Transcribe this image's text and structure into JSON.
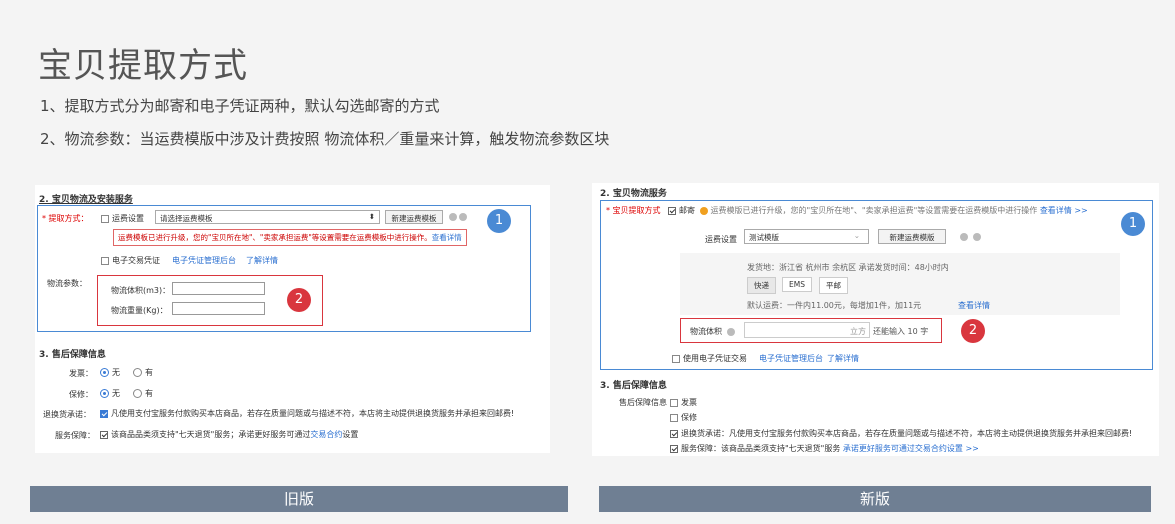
{
  "slide": {
    "title": "宝贝提取方式",
    "point1": "1、提取方式分为邮寄和电子凭证两种，默认勾选邮寄的方式",
    "point2": "2、物流参数：当运费模版中涉及计费按照 物流体积／重量来计算，触发物流参数区块"
  },
  "old": {
    "section2": "2. 宝贝物流及安装服务",
    "method_label": "* 提取方式：",
    "freight_option": "运费设置",
    "freight_select": "请选择运费模板",
    "new_template_btn": "新建运费模板",
    "notice": "运费模板已进行升级，您的\"宝贝所在地\"、\"卖家承担运费\"等设置需要在运费模板中进行操作。",
    "notice_link": "查看详情",
    "ecert_option": "电子交易凭证",
    "ecert_link": "电子凭证管理后台",
    "learn_more": "了解详情",
    "logistics_label": "物流参数：",
    "volume_label": "物流体积(m3)：",
    "weight_label": "物流重量(Kg)：",
    "section3": "3. 售后保障信息",
    "invoice_label": "发票：",
    "warranty_label": "保修：",
    "opt_none": "无",
    "opt_have": "有",
    "return_label": "退换货承诺：",
    "return_text": "凡使用支付宝服务付款购买本店商品，若存在质量问题或与描述不符，本店将主动提供退换货服务并承担来回邮费!",
    "service_label": "服务保障：",
    "service_text_a": "该商品品类须支持\"七天退货\"服务；承诺更好服务可通过",
    "service_link": "交易合约",
    "service_text_b": "设置",
    "badge1": "1",
    "badge2": "2",
    "bar_label": "旧版"
  },
  "new": {
    "section2": "2. 宝贝物流服务",
    "method_label": "* 宝贝提取方式",
    "mail_option": "邮寄",
    "notice": "运费模版已进行升级，您的\"宝贝所在地\"、\"卖家承担运费\"等设置需要在运费模版中进行操作",
    "notice_link": "查看详情 >>",
    "freight_label": "运费设置",
    "freight_select": "测试模版",
    "new_template_btn": "新建运费模版",
    "ship_info": "发货地：浙江省 杭州市 余杭区   承诺发货时间：48小时内",
    "tab_express": "快递",
    "tab_ems": "EMS",
    "tab_post": "平邮",
    "default_fee": "默认运费：一件内11.00元，每增加1件，加11元",
    "fee_link": "查看详情",
    "volume_label": "物流体积",
    "volume_unit": "立方",
    "volume_hint": "还能输入 10 字",
    "ecert_option": "使用电子凭证交易",
    "ecert_link": "电子凭证管理后台",
    "learn_more": "了解详情",
    "section3": "3. 售后保障信息",
    "aftersale_label": "售后保障信息",
    "invoice": "发票",
    "warranty": "保修",
    "return_text": "退换货承诺：凡使用支付宝服务付款购买本店商品，若存在质量问题或与描述不符，本店将主动提供退换货服务并承担来回邮费!",
    "service_text": "服务保障：该商品品类须支持\"七天退货\"服务",
    "service_link": "承诺更好服务可通过交易合约设置 >>",
    "badge1": "1",
    "badge2": "2",
    "bar_label": "新版"
  }
}
